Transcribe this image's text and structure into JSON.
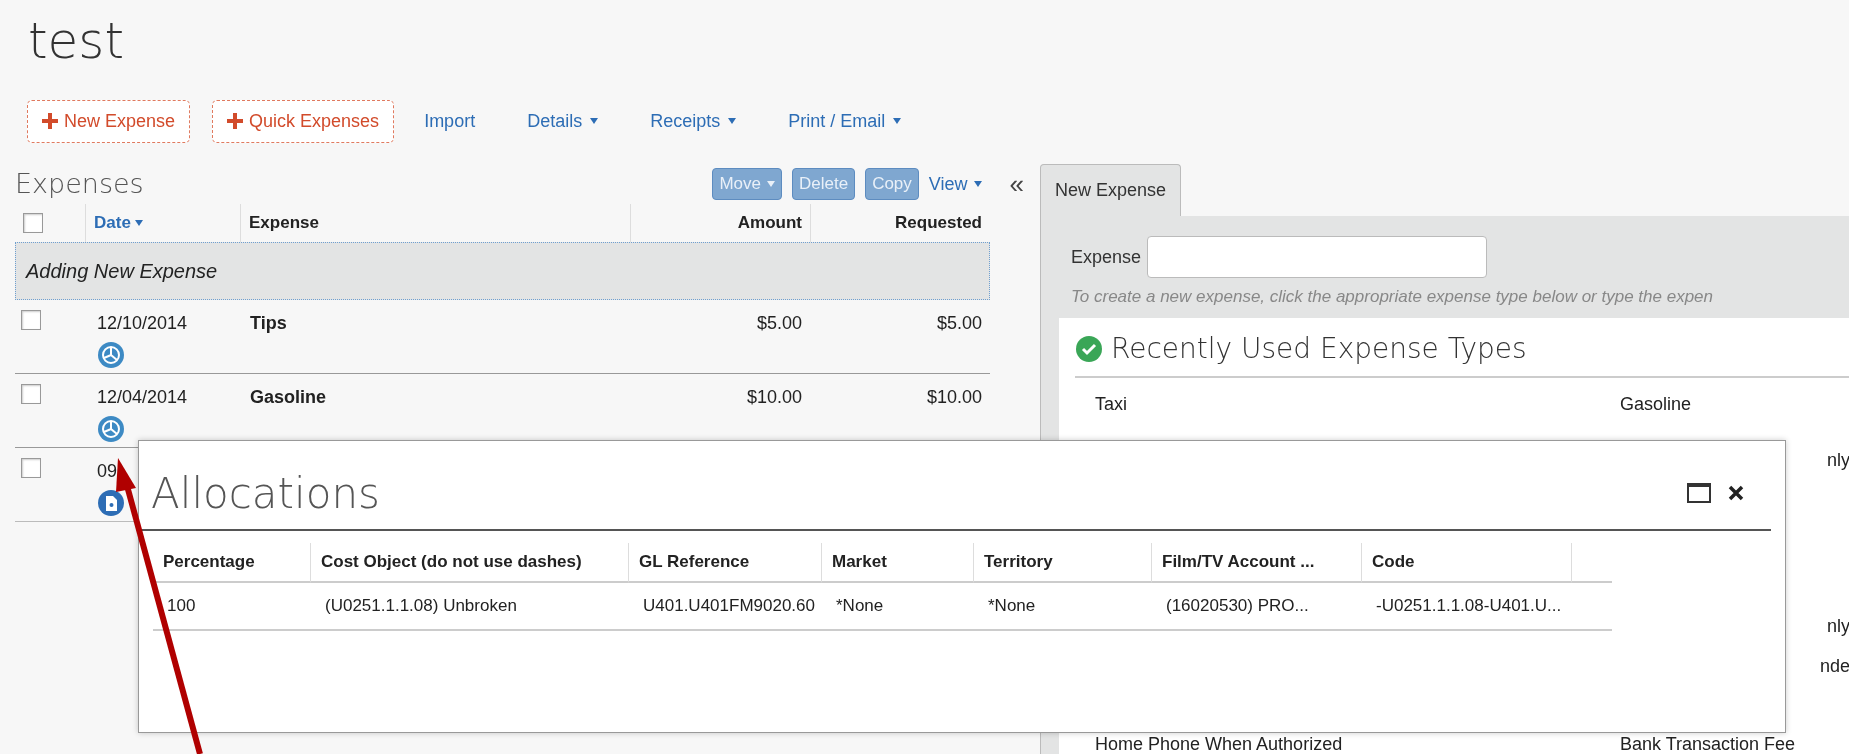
{
  "page": {
    "title": "test"
  },
  "toolbar": [
    {
      "kind": "add",
      "label": "New Expense"
    },
    {
      "kind": "add",
      "label": "Quick Expenses"
    },
    {
      "kind": "link",
      "label": "Import"
    },
    {
      "kind": "menu",
      "label": "Details"
    },
    {
      "kind": "menu",
      "label": "Receipts"
    },
    {
      "kind": "menu",
      "label": "Print / Email"
    }
  ],
  "expenses": {
    "title": "Expenses",
    "actions": [
      {
        "kind": "button",
        "label": "Move",
        "caret": true
      },
      {
        "kind": "button",
        "label": "Delete",
        "caret": false
      },
      {
        "kind": "button",
        "label": "Copy",
        "caret": false
      },
      {
        "kind": "link",
        "label": "View",
        "caret": true
      }
    ],
    "collapse": "«",
    "header_checked": false,
    "columns": [
      {
        "label": "Date",
        "sorted": true
      },
      {
        "label": "Expense",
        "sorted": false
      },
      {
        "label": "Amount",
        "sorted": false
      },
      {
        "label": "Requested",
        "sorted": false
      }
    ],
    "adding_row": "Adding New Expense",
    "rows": [
      {
        "checked": false,
        "date": "12/10/2014",
        "expense": "Tips",
        "amount": "$5.00",
        "requested": "$5.00",
        "kind": "allocation"
      },
      {
        "checked": false,
        "date": "12/04/2014",
        "expense": "Gasoline",
        "amount": "$10.00",
        "requested": "$10.00",
        "kind": "allocation"
      },
      {
        "checked": false,
        "date": "09",
        "kind": "receipt"
      }
    ]
  },
  "detail": {
    "tabs": [
      {
        "label": "New Expense",
        "selected": true
      }
    ],
    "field_label": "Expense",
    "hint": "To create a new expense, click the appropriate expense type below or type the expen",
    "section_title": "Recently Used Expense Types",
    "type_rows": [
      {
        "left": "Taxi",
        "right": "Gasoline"
      },
      {
        "edge": "nly"
      },
      {
        "edge": "nly"
      },
      {
        "edge": "nde"
      },
      {
        "left": "Home Phone When Authorized",
        "right": "Bank Transaction Fee"
      }
    ]
  },
  "dialog": {
    "title": "Allocations",
    "columns": [
      "Percentage",
      "Cost Object (do not use dashes)",
      "GL Reference",
      "Market",
      "Territory",
      "Film/TV Account ...",
      "Code"
    ],
    "rows": [
      [
        "100",
        "(U0251.1.1.08) Unbroken",
        "U401.U401FM9020.60",
        "*None",
        "*None",
        "(16020530) PRO...",
        "-U0251.1.1.08-U401.U..."
      ]
    ]
  }
}
